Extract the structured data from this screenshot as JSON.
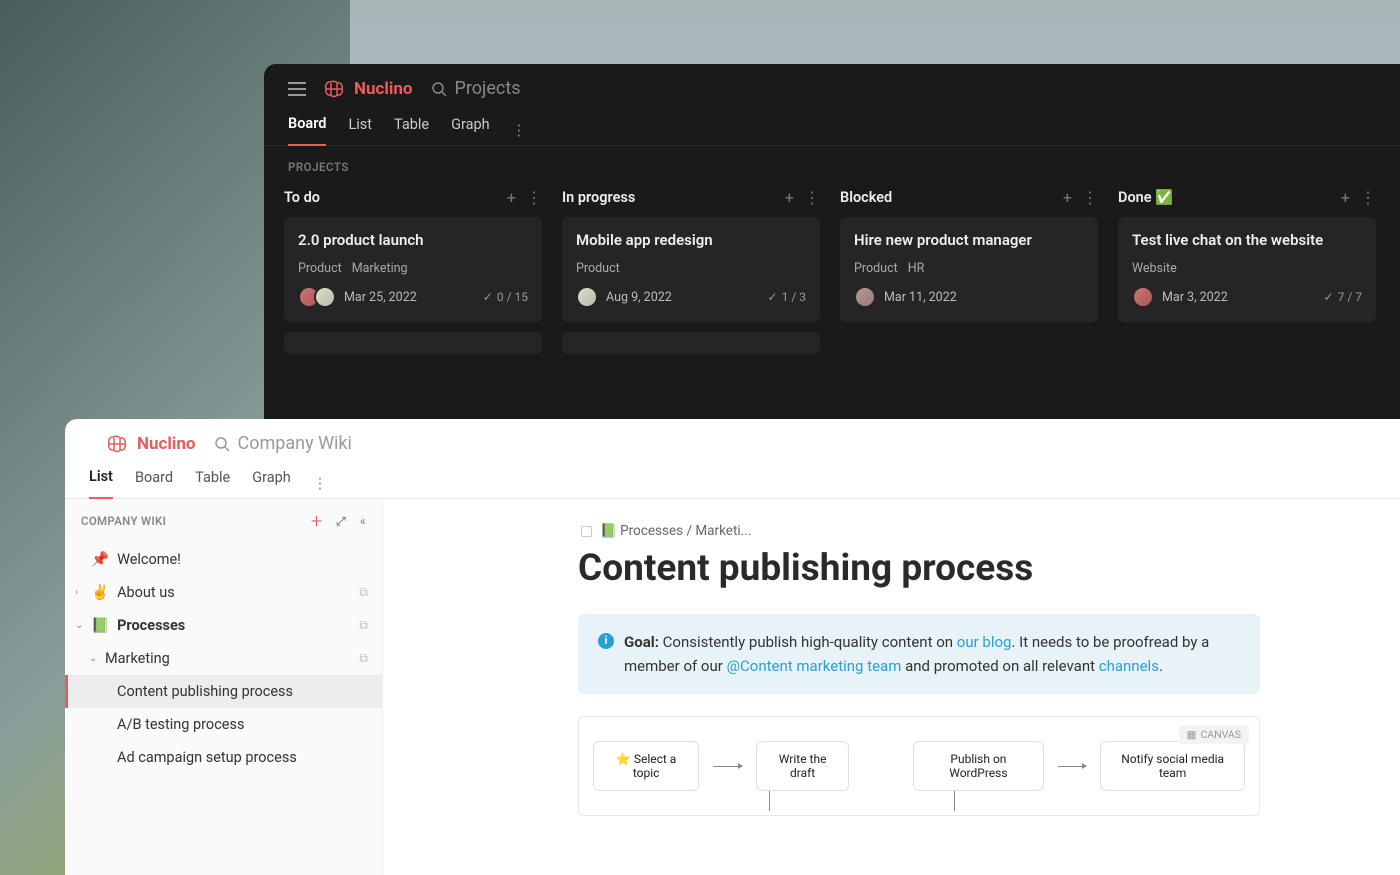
{
  "brand_name": "Nuclino",
  "dark": {
    "search_label": "Projects",
    "tabs": [
      "Board",
      "List",
      "Table",
      "Graph"
    ],
    "active_tab": 0,
    "section": "PROJECTS",
    "columns": [
      {
        "title": "To do",
        "card": {
          "title": "2.0 product launch",
          "tags": [
            "Product",
            "Marketing"
          ],
          "avatars": 2,
          "date": "Mar 25, 2022",
          "progress": "0 / 15"
        }
      },
      {
        "title": "In progress",
        "card": {
          "title": "Mobile app redesign",
          "tags": [
            "Product"
          ],
          "avatars": 1,
          "date": "Aug 9, 2022",
          "progress": "1 / 3"
        }
      },
      {
        "title": "Blocked",
        "card": {
          "title": "Hire new product manager",
          "tags": [
            "Product",
            "HR"
          ],
          "avatars": 1,
          "date": "Mar 11, 2022",
          "progress": ""
        }
      },
      {
        "title": "Done ✅",
        "card": {
          "title": "Test live chat on the website",
          "tags": [
            "Website"
          ],
          "avatars": 1,
          "date": "Mar 3, 2022",
          "progress": "7 / 7"
        }
      }
    ]
  },
  "light": {
    "search_label": "Company Wiki",
    "tabs": [
      "List",
      "Board",
      "Table",
      "Graph"
    ],
    "active_tab": 0,
    "sidebar_label": "COMPANY WIKI",
    "tree": {
      "welcome": "Welcome!",
      "about": "About us",
      "processes": "Processes",
      "marketing": "Marketing",
      "items": [
        "Content publishing process",
        "A/B testing process",
        "Ad campaign setup process"
      ]
    },
    "breadcrumb": "📗 Processes / Marketi...",
    "page_title": "Content publishing process",
    "callout": {
      "goal_label": "Goal:",
      "t1": " Consistently publish high-quality content on ",
      "link1": "our blog",
      "t2": ". It needs to be proofread by a member of our ",
      "link2": "@Content marketing team",
      "t3": " and promoted on all relevant ",
      "link3": "channels",
      "t4": "."
    },
    "canvas_label": "CANVAS",
    "nodes": [
      "⭐ Select a topic",
      "Write the draft",
      "Publish on WordPress",
      "Notify social media team"
    ]
  }
}
